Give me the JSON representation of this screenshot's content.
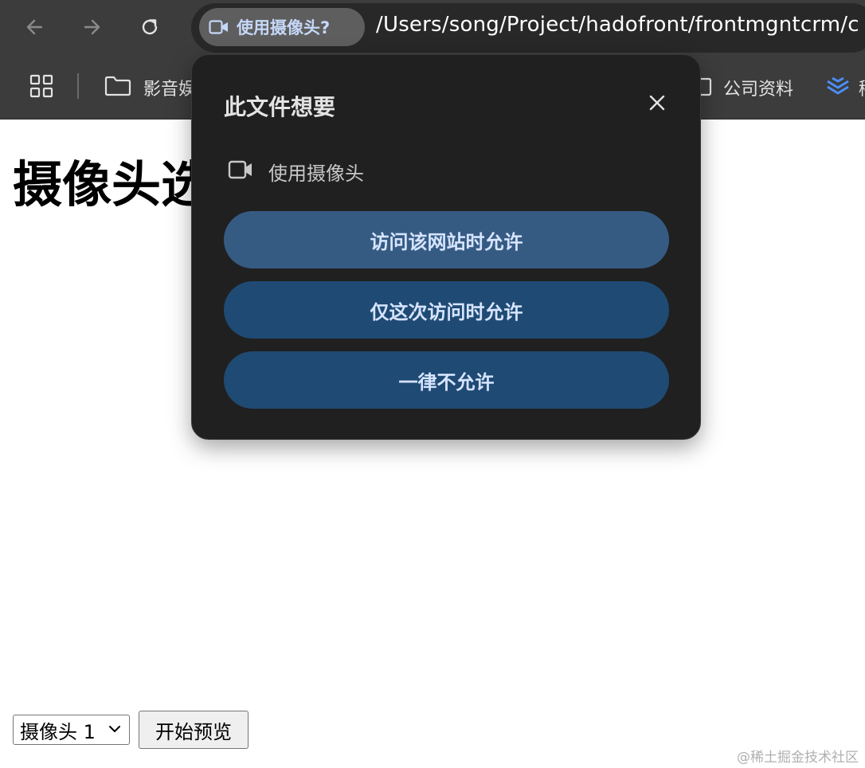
{
  "browser": {
    "address_bar": {
      "permission_chip_label": "使用摄像头?",
      "url": "/Users/song/Project/hadofront/frontmgntcrm/c"
    },
    "bookmarks": [
      {
        "label": "影音娱",
        "icon": "folder-icon"
      },
      {
        "label": "公司资料",
        "icon": "document-icon"
      },
      {
        "label": "稀",
        "icon": "layers-icon"
      }
    ]
  },
  "page": {
    "heading": "摄像头选",
    "camera_select": {
      "selected": "摄像头 1"
    },
    "start_button_label": "开始预览",
    "watermark": "@稀土掘金技术社区"
  },
  "dialog": {
    "title": "此文件想要",
    "permission_label": "使用摄像头",
    "buttons": {
      "allow_site": "访问该网站时允许",
      "allow_once": "仅这次访问时允许",
      "never_allow": "一律不允许"
    }
  },
  "colors": {
    "chrome_bg": "#3c3c3c",
    "dialog_bg": "#202020",
    "primary_button": "#365b83",
    "secondary_button": "#1f4a73",
    "button_text": "#d6e4ff"
  }
}
